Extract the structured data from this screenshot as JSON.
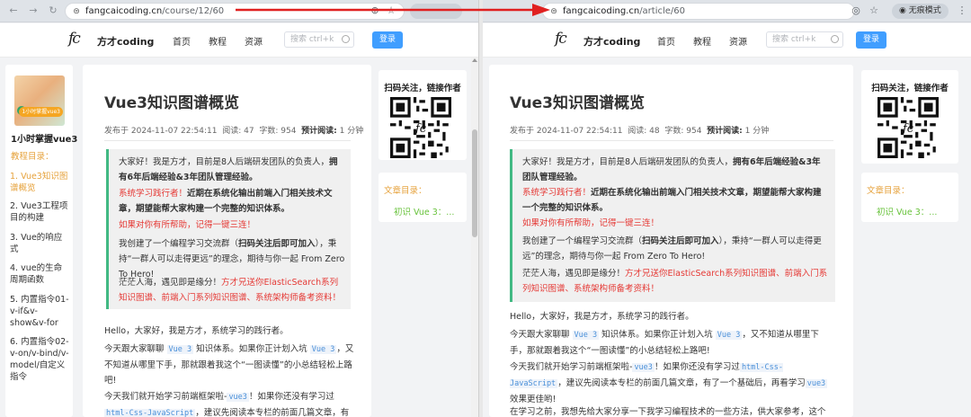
{
  "browser": {
    "left_url": {
      "domain": "fangcaicoding.cn",
      "path": "/course/12/60"
    },
    "right_url": {
      "domain": "fangcaicoding.cn",
      "path": "/article/60"
    },
    "incognito_label": "无痕模式"
  },
  "site": {
    "logo_mark": "fc",
    "brand": "方才coding",
    "nav": [
      "首页",
      "教程",
      "资源"
    ],
    "search_placeholder": "搜索 ctrl+k",
    "login": "登录"
  },
  "course": {
    "cover_badge": "1小时掌握vue3",
    "title": "1小时掌握vue3",
    "toc_label": "教程目录：",
    "items": [
      {
        "text": "1. Vue3知识图谱概览",
        "active": true
      },
      {
        "text": "2. Vue3工程项目的构建",
        "active": false
      },
      {
        "text": "3. Vue的响应式",
        "active": false
      },
      {
        "text": "4. vue的生命周期函数",
        "active": false
      },
      {
        "text": "5. 内置指令01-v-if&v-show&v-for",
        "active": false
      },
      {
        "text": "6. 内置指令02-v-on/v-bind/v-model/自定义指令",
        "active": false
      }
    ]
  },
  "article": {
    "title": "Vue3知识图谱概览",
    "date_prefix": "发布于",
    "date": "2024-11-07 22:54:11",
    "reads_label": "阅读:",
    "reads_left": "47",
    "reads_right": "48",
    "words_label": "字数:",
    "words": "954",
    "est_label": "预计阅读:",
    "est_value": "1 分钟",
    "quote": {
      "p1a": "大家好！我是方才，目前是8人后端研发团队的负责人，",
      "p1b": "拥有6年后端经验&3年团队管理经验。",
      "p2a": "系统学习践行者！",
      "p2b": "近期在系统化输出前端入门相关技术文章，期望能帮大家构建一个完整的知识体系。",
      "p3": "如果对你有所帮助，记得一键三连！",
      "p4a": "我创建了一个编程学习交流群（",
      "p4b": "扫码关注后即可加入",
      "p4c": "），秉持“一群人可以走得更远”的理念，期待与你一起 From Zero To Hero!",
      "p5a": "茫茫人海，遇见即是缘分！",
      "p5b": "方才兄送你ElasticSearch系列知识图谱、前端入门系列知识图谱、系统架构师备考资料！"
    },
    "body": {
      "hello": "Hello，大家好，我是方才，系统学习的践行者。",
      "p2a": "今天跟大家聊聊",
      "vue3": "Vue 3",
      "p2b": "知识体系。如果你正计划入坑",
      "p2c": "，又不知道从哪里下手，那就跟着我这个“一图读懂”的小总结轻松上路吧!",
      "p3a": "今天我们就开始学习前端框架啦-",
      "p3code1": "vue3",
      "p3b": "！如果你还没有学习过",
      "p3code2": "html-Css-JavaScript",
      "p3c": "，建议先阅读本专栏的前面几篇文章，有了一个基础后，再看学习",
      "p3code3": "vue3",
      "p3d": "效果更佳哟!",
      "p4": "在学习之前，我想先给大家分享一下我学习编程技术的一些方法，供大家参考，这个"
    }
  },
  "sidebar": {
    "qr_title": "扫码关注，链接作者",
    "toc_label": "文章目录：",
    "toc_item": "初识 Vue 3：..."
  }
}
